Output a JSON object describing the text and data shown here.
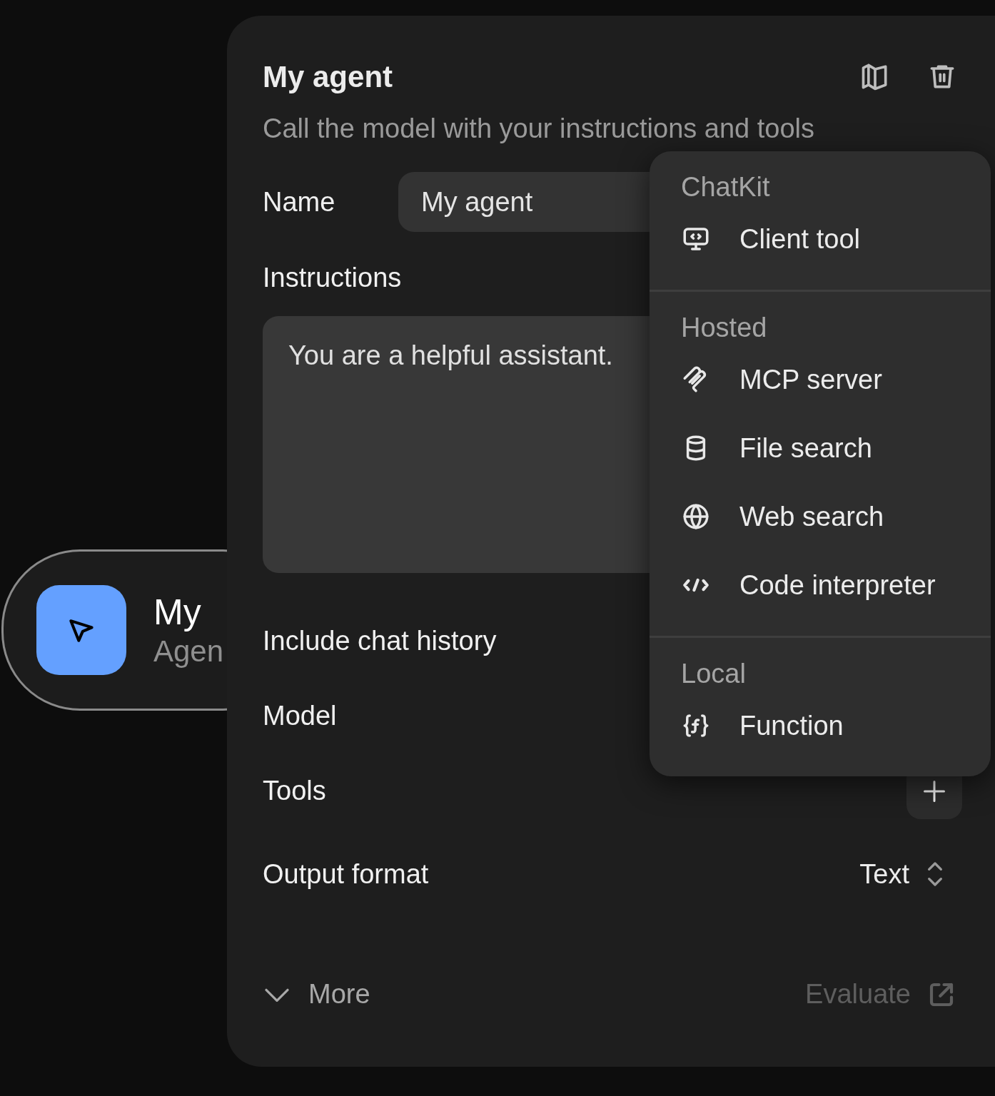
{
  "node": {
    "title": "My",
    "subtitle": "Agen"
  },
  "panel": {
    "title": "My agent",
    "subtitle": "Call the model with your instructions and tools",
    "name": {
      "label": "Name",
      "value": "My agent"
    },
    "instructions": {
      "label": "Instructions",
      "value": "You are a helpful assistant."
    },
    "rows": [
      {
        "label": "Include chat history",
        "kind": "plain"
      },
      {
        "label": "Model",
        "kind": "plain"
      },
      {
        "label": "Tools",
        "kind": "add"
      },
      {
        "label": "Output format",
        "kind": "select",
        "value": "Text"
      }
    ],
    "more": "More",
    "evaluate": "Evaluate"
  },
  "menu": {
    "sections": [
      {
        "heading": "ChatKit",
        "items": [
          {
            "label": "Client tool",
            "kind": "client"
          }
        ]
      },
      {
        "heading": "Hosted",
        "items": [
          {
            "label": "MCP server",
            "kind": "mcp"
          },
          {
            "label": "File search",
            "kind": "file"
          },
          {
            "label": "Web search",
            "kind": "web"
          },
          {
            "label": "Code interpreter",
            "kind": "code"
          }
        ]
      },
      {
        "heading": "Local",
        "items": [
          {
            "label": "Function",
            "kind": "function"
          }
        ]
      }
    ]
  }
}
